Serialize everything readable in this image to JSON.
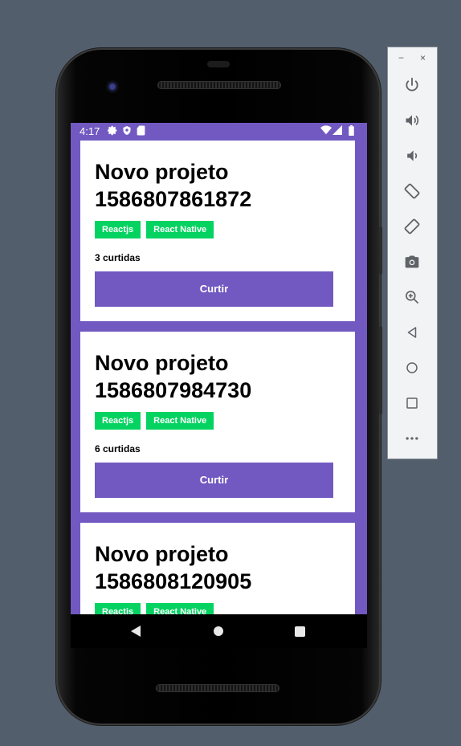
{
  "status_bar": {
    "time": "4:17",
    "icons": [
      "gear-icon",
      "shield-icon",
      "sd-card-icon",
      "wifi-icon",
      "signal-icon",
      "battery-icon"
    ]
  },
  "projects": [
    {
      "title": "Novo projeto 1586807861872",
      "techs": [
        "Reactjs",
        "React Native"
      ],
      "likes_text": "3 curtidas",
      "button_label": "Curtir"
    },
    {
      "title": "Novo projeto 1586807984730",
      "techs": [
        "Reactjs",
        "React Native"
      ],
      "likes_text": "6 curtidas",
      "button_label": "Curtir"
    },
    {
      "title": "Novo projeto 1586808120905",
      "techs": [
        "Reactjs",
        "React Native"
      ],
      "likes_text": "",
      "button_label": ""
    }
  ],
  "nav_bar": {
    "icons": [
      "back-icon",
      "home-icon",
      "recents-icon"
    ]
  },
  "emulator_toolbar": {
    "window_controls": {
      "minimize": "−",
      "close": "×"
    },
    "items": [
      "power-icon",
      "volume-up-icon",
      "volume-down-icon",
      "rotate-left-icon",
      "rotate-right-icon",
      "camera-icon",
      "zoom-icon",
      "back-icon",
      "home-icon",
      "overview-icon",
      "more-icon"
    ]
  },
  "colors": {
    "background": "#525e6b",
    "primary": "#7159c1",
    "tag": "#04d361",
    "card": "#ffffff"
  }
}
